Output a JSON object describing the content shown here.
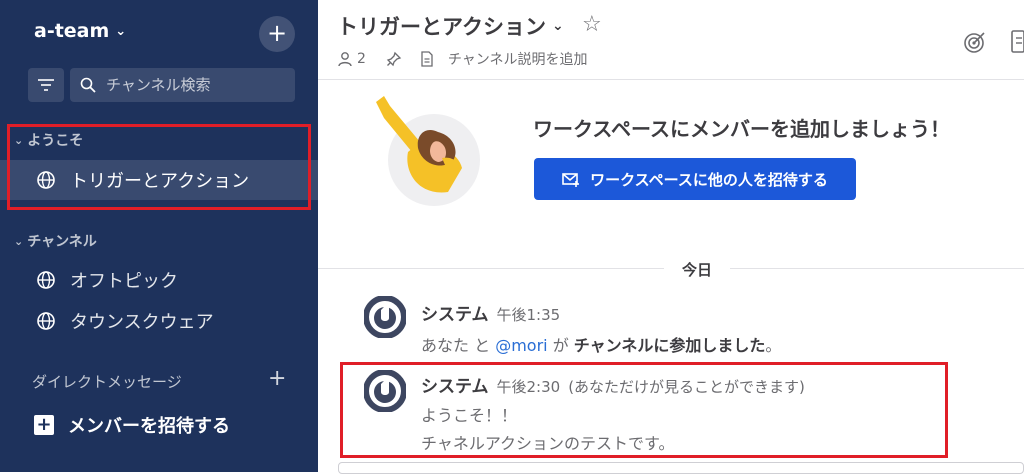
{
  "sidebar": {
    "workspace_name": "a-team",
    "search": {
      "placeholder": "チャンネル検索"
    },
    "sections": [
      {
        "label": "ようこそ",
        "items": [
          {
            "label": "トリガーとアクション",
            "active": true
          }
        ]
      },
      {
        "label": "チャンネル",
        "items": [
          {
            "label": "オフトピック"
          },
          {
            "label": "タウンスクウェア"
          }
        ]
      }
    ],
    "dm_header": "ダイレクトメッセージ",
    "invite_label": "メンバーを招待する"
  },
  "channel": {
    "title": "トリガーとアクション",
    "member_count": "2",
    "add_description": "チャンネル説明を追加"
  },
  "intro": {
    "title": "ワークスペースにメンバーを追加しましょう！",
    "invite_button": "ワークスペースに他の人を招待する"
  },
  "date_separator": "今日",
  "posts": [
    {
      "author": "システム",
      "time": "午後1:35",
      "parts": {
        "you": "あなた",
        "and": " と ",
        "mention": "@mori",
        "ga": " が ",
        "joined": "チャンネルに参加しました",
        "end": "。"
      }
    },
    {
      "author": "システム",
      "time": "午後2:30",
      "note": "(あなただけが見ることができます)",
      "lines": [
        "ようこそ！！",
        "チャネルアクションのテストです。"
      ]
    }
  ],
  "colors": {
    "sidebar_bg": "#1e325c",
    "accent": "#1c58d9",
    "mention": "#2a6ed5",
    "highlight_box": "#e01e28"
  },
  "icons": [
    "plus-icon",
    "filter-icon",
    "search-icon",
    "globe-icon",
    "star-icon",
    "member-icon",
    "pin-icon",
    "file-icon",
    "target-icon",
    "board-icon",
    "mail-plus-icon",
    "system-avatar-icon"
  ]
}
